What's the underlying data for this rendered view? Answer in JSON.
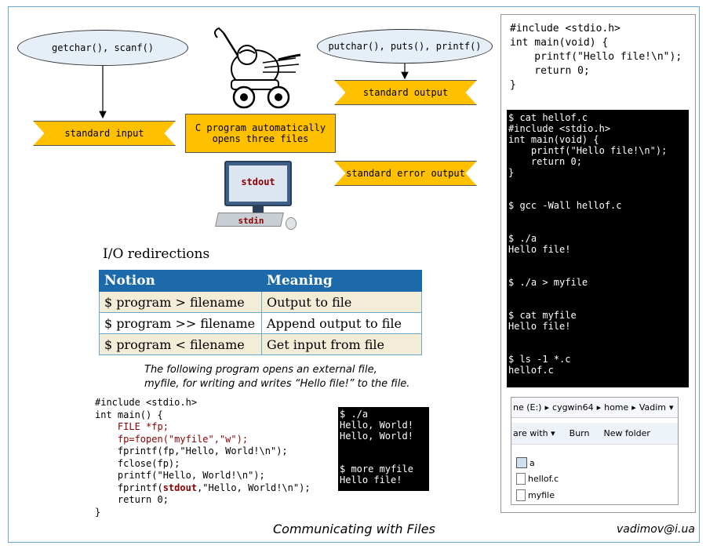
{
  "diagram": {
    "input_funcs": "getchar(), scanf()",
    "output_funcs": "putchar(), puts(), printf()",
    "std_input": "standard input",
    "std_output": "standard output",
    "std_error": "standard error output",
    "center": "C program automatically opens three files",
    "monitor_stdout": "stdout",
    "keyboard_stdin": "stdin"
  },
  "io_table": {
    "title": "I/O redirections",
    "headers": [
      "Notion",
      "Meaning"
    ],
    "rows": [
      [
        "$ program > filename",
        "Output to file"
      ],
      [
        "$ program >> filename",
        "Append output to file"
      ],
      [
        "$ program < filename",
        "Get input from file"
      ]
    ]
  },
  "program_caption": "The following program opens an external file, myfile, for writing and writes “Hello file!” to the file.",
  "program_code": {
    "l1": "#include <stdio.h>",
    "l2": "int main() {",
    "l3": "    FILE *fp;",
    "l4": "    fp=fopen(\"myfile\",\"w\");",
    "l5": "    fprintf(fp,\"Hello, World!\\n\");",
    "l6": "    fclose(fp);",
    "l7": "    printf(\"Hello, World!\\n\");",
    "l8a": "    fprintf(",
    "l8b": "stdout",
    "l8c": ",\"Hello, World!\\n\");",
    "l9": "    return 0;",
    "l10": "}"
  },
  "small_terminal": "$ ./a\nHello, World!\nHello, World!\n\n\n$ more myfile\nHello file!",
  "right_code": "#include <stdio.h>\nint main(void) {\n    printf(\"Hello file!\\n\");\n    return 0;\n}",
  "right_terminal": "$ cat hellof.c\n#include <stdio.h>\nint main(void) {\n    printf(\"Hello file!\\n\");\n    return 0;\n}\n\n\n$ gcc -Wall hellof.c\n\n\n$ ./a\nHello file!\n\n\n$ ./a > myfile\n\n\n$ cat myfile\nHello file!\n\n\n$ ls -1 *.c\nhellof.c",
  "explorer": {
    "path": [
      "ne (E:)",
      "cygwin64",
      "home",
      "Vadim"
    ],
    "toolbar": [
      "are with",
      "Burn",
      "New folder"
    ],
    "files": [
      "a",
      "hellof.c",
      "myfile"
    ]
  },
  "footer": {
    "title": "Communicating with Files",
    "author": "vadimov@i.ua"
  },
  "colors": {
    "ribbon": "#ffc000",
    "table_header": "#1c6aa9",
    "table_stripe": "#f3ecd6",
    "ellipse": "#e6eef8",
    "code_red": "#8b0000"
  }
}
